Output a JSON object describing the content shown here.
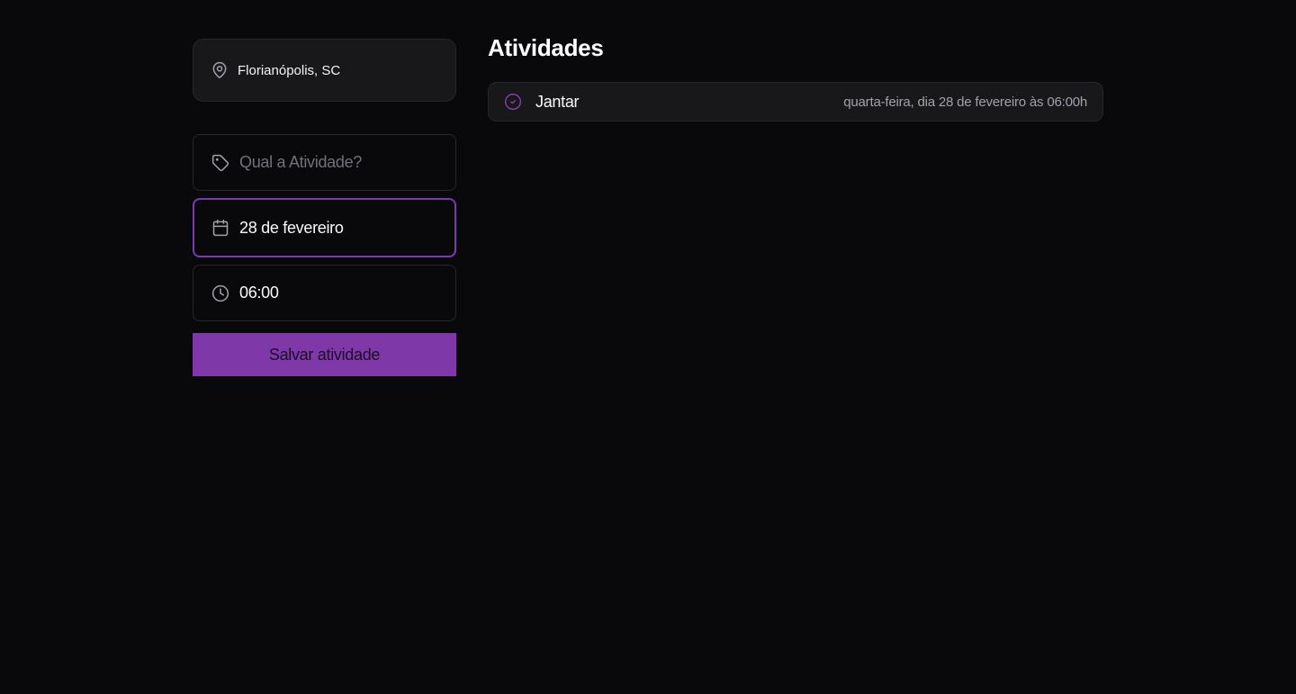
{
  "location": {
    "icon": "map-pin-icon",
    "label": "Florianópolis, SC"
  },
  "form": {
    "activity": {
      "icon": "tag-icon",
      "placeholder": "Qual a Atividade?",
      "value": ""
    },
    "date": {
      "icon": "calendar-icon",
      "value": "28 de fevereiro"
    },
    "time": {
      "icon": "clock-icon",
      "value": "06:00"
    },
    "save_label": "Salvar atividade"
  },
  "activities": {
    "title": "Atividades",
    "items": [
      {
        "icon": "check-circle-icon",
        "name": "Jantar",
        "when": "quarta-feira, dia 28 de fevereiro às 06:00h"
      }
    ]
  },
  "colors": {
    "background": "#09090b",
    "card": "#18181b",
    "border": "#27272a",
    "accent": "#7e38a8",
    "focus_border": "#7c3aad",
    "muted_text": "#a1a1aa",
    "placeholder_text": "#71717a"
  }
}
